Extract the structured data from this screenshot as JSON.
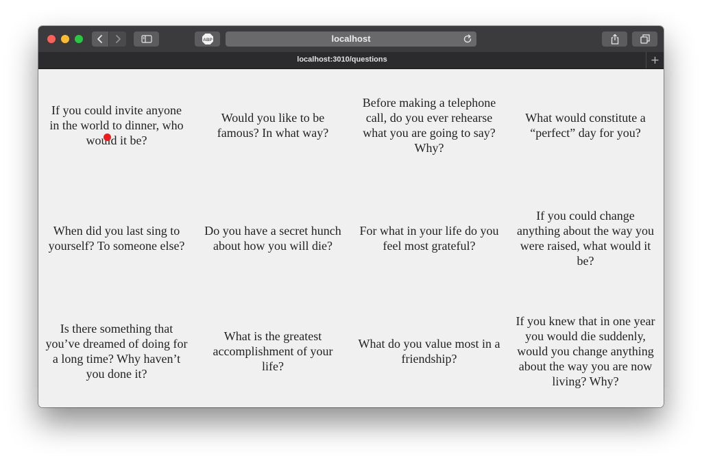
{
  "browser": {
    "address": "localhost",
    "tab_title": "localhost:3010/questions",
    "new_tab_label": "+",
    "abp_label": "ABP"
  },
  "questions": [
    "If you could invite anyone in the world to dinner, who would it be?",
    "Would you like to be famous? In what way?",
    "Before making a telephone call, do you ever rehearse what you are going to say? Why?",
    "What would constitute a “perfect” day for you?",
    "When did you last sing to yourself? To someone else?",
    "Do you have a secret hunch about how you will die?",
    "For what in your life do you feel most grateful?",
    "If you could change anything about the way you were raised, what would it be?",
    "Is there something that you’ve dreamed of doing for a long time? Why haven’t you done it?",
    "What is the greatest accomplishment of your life?",
    "What do you value most in a friendship?",
    "If you knew that in one year you would die suddenly, would you change anything about the way you are now living? Why?"
  ],
  "colors": {
    "page_background": "#eff0ef",
    "text": "#222222",
    "cursor_marker": "#f21b1b"
  }
}
